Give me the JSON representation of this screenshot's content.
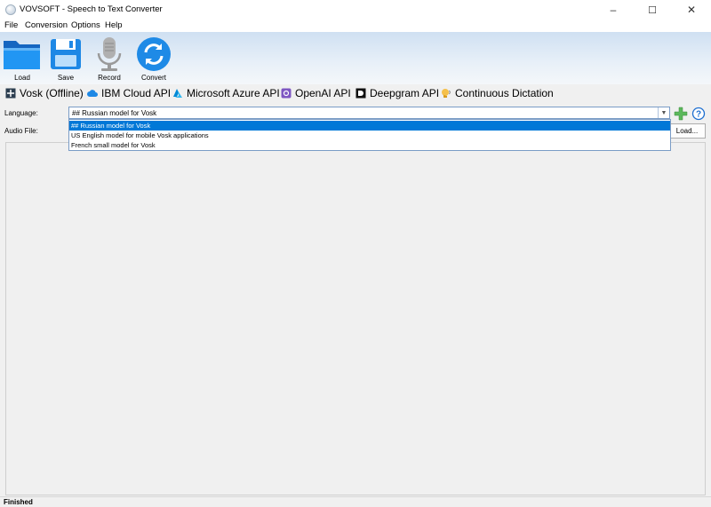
{
  "window": {
    "title": "VOVSOFT - Speech to Text Converter",
    "minimize": "–",
    "maximize": "☐",
    "close": "✕"
  },
  "menu": [
    "File",
    "Conversion",
    "Options",
    "Help"
  ],
  "toolbar": {
    "load": "Load",
    "save": "Save",
    "record": "Record",
    "convert": "Convert"
  },
  "tabs": [
    "Vosk (Offline)",
    "IBM Cloud API",
    "Microsoft Azure API",
    "OpenAI API",
    "Deepgram API",
    "Continuous Dictation"
  ],
  "form": {
    "language_label": "Language:",
    "language_value": "## Russian model for Vosk",
    "audio_label": "Audio File:",
    "load_button": "Load...",
    "options": [
      "## Russian model for Vosk",
      "US English model for mobile Vosk applications",
      "French small model for Vosk"
    ]
  },
  "status": {
    "text": "Finished"
  },
  "colors": {
    "accent": "#0078d7",
    "icon_blue": "#1e8ae6"
  }
}
